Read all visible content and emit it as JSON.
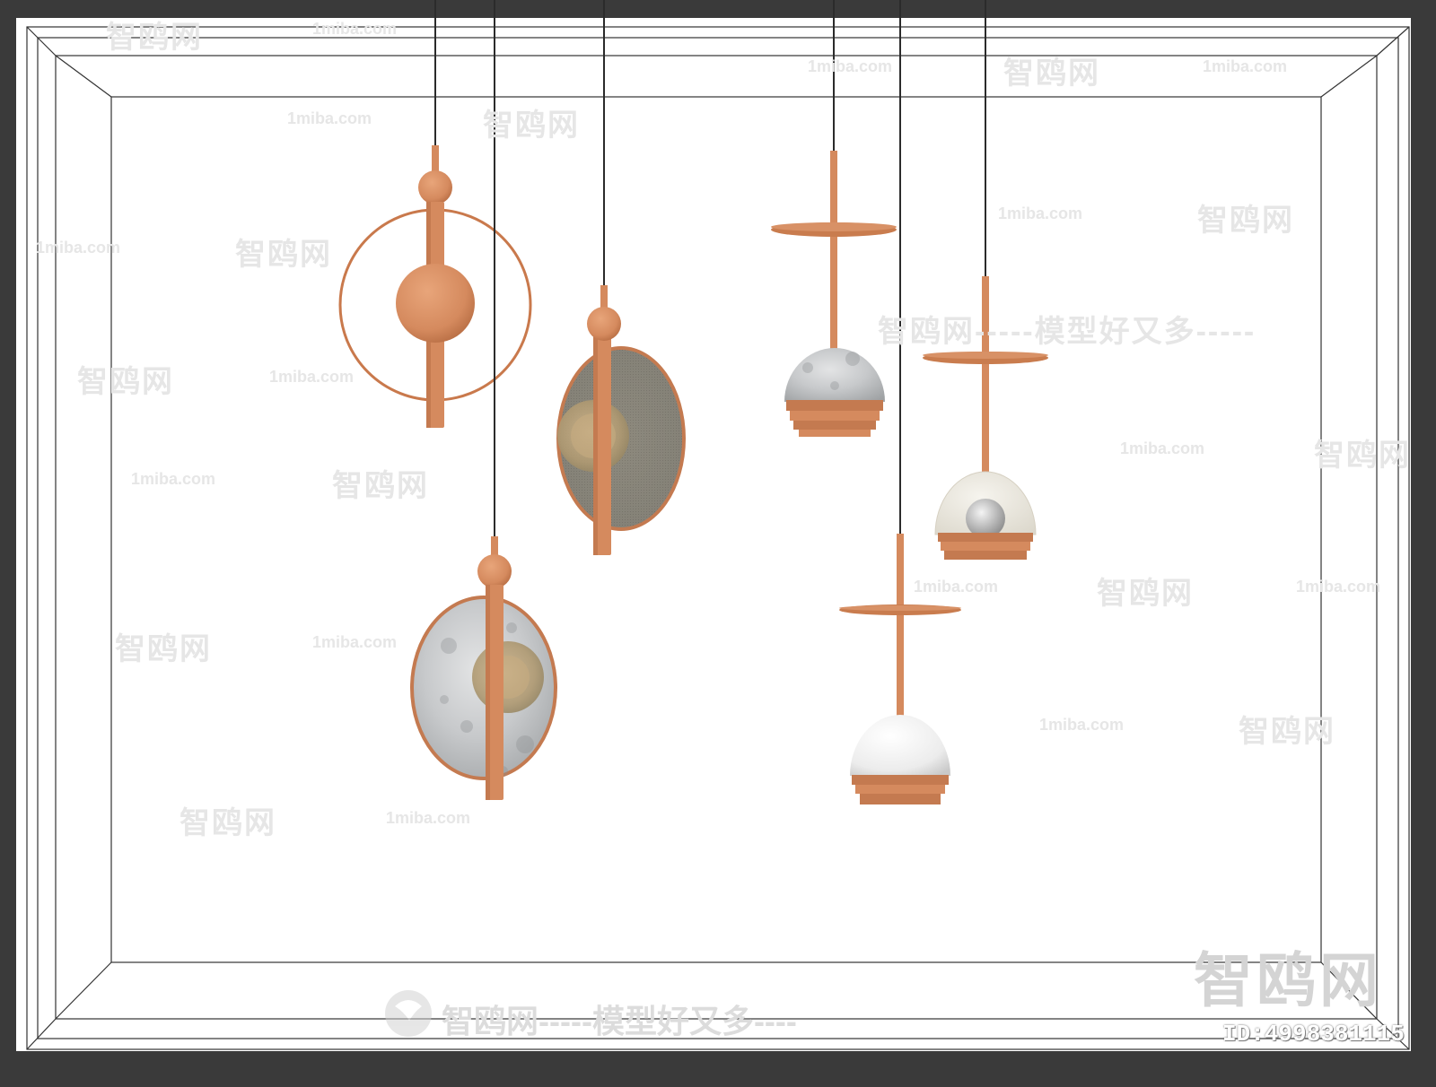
{
  "colors": {
    "frame_outer": "#3a3a3a",
    "canvas": "#ffffff",
    "copper": "#d58a5e",
    "copper_dark": "#b9693e",
    "cord": "#2b2b2b",
    "marble": "#c9cbcc",
    "smoke_glass": "#8a8a80",
    "frosted_glass": "#ece9e1",
    "watermark": "#e4e4e4"
  },
  "watermarks": {
    "site": "1miba.com",
    "brand": "智鸥网",
    "slogan": "智鸥网-----模型好又多----",
    "slogan_mid": "智鸥网-----模型好又多-----",
    "dashes": "------",
    "id_label": "ID:4998381115",
    "big_logo": "智鸥网"
  },
  "lamps": [
    {
      "name": "ring-pendant",
      "style": "copper ring with sphere"
    },
    {
      "name": "smoke-oval-pendant",
      "style": "smoked glass oval"
    },
    {
      "name": "marble-oval-pendant",
      "style": "marble oval"
    },
    {
      "name": "marble-dome-pendant",
      "style": "marble dome with disc"
    },
    {
      "name": "frosted-dome-pendant",
      "style": "frosted glass dome with disc"
    },
    {
      "name": "white-dome-pendant",
      "style": "white dome with disc"
    }
  ]
}
